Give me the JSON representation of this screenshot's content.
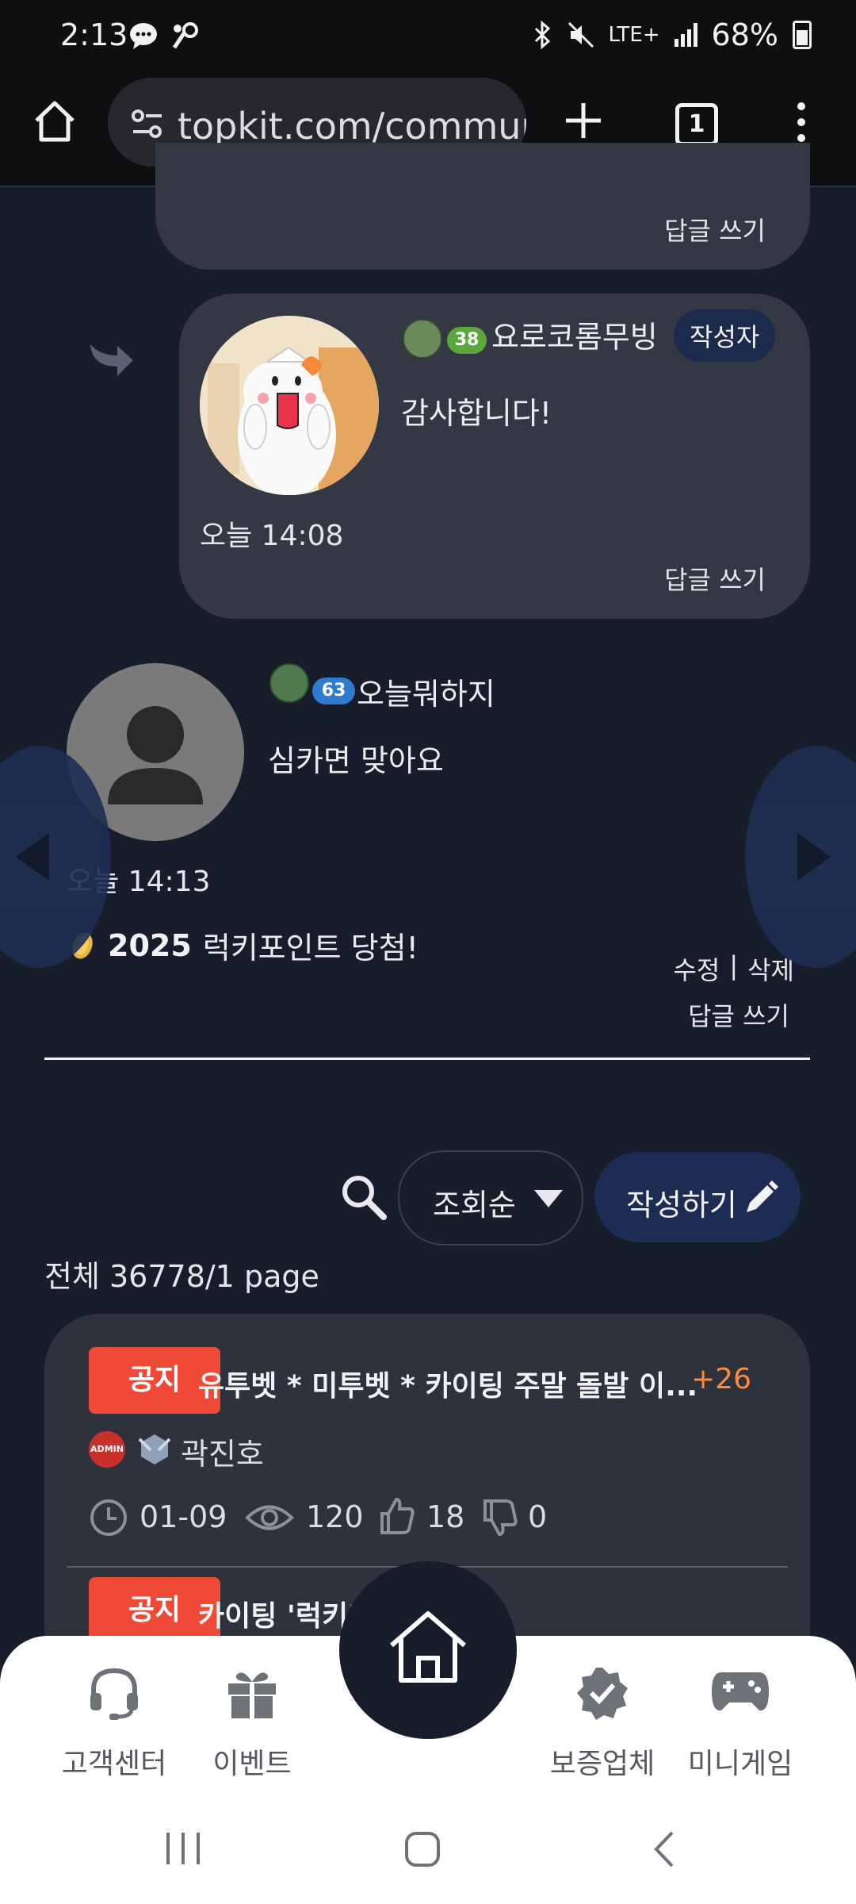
{
  "status_bar": {
    "time": "2:13",
    "network": "LTE+",
    "battery": "68%"
  },
  "browser": {
    "url": "topkit.com/communi",
    "tab_count": "1"
  },
  "comments": [
    {
      "reply_link": "답글 쓰기"
    },
    {
      "nickname": "요로코롬무빙",
      "level": "38",
      "author_badge": "작성자",
      "text": "감사합니다!",
      "time": "오늘 14:08",
      "reply_link": "답글 쓰기"
    },
    {
      "nickname": "오늘뭐하지",
      "level": "63",
      "text": "심카면 맞아요",
      "time": "오늘 14:13",
      "lucky_year": "2025",
      "lucky_text": "럭키포인트 당첨!",
      "edit": "수정",
      "separator": "|",
      "delete": "삭제",
      "reply_link": "답글 쓰기"
    }
  ],
  "toolbar": {
    "sort_label": "조회순",
    "write_label": "작성하기",
    "total_text": "전체 36778/1 page"
  },
  "posts": [
    {
      "badge": "공지",
      "title": "유투벳 * 미투벳 * 카이팅 주말 돌발 이...",
      "comment_count": "+26",
      "author_badge_text": "ADMIN",
      "author": "곽진호",
      "date": "01-09",
      "views": "120",
      "likes": "18",
      "dislikes": "0"
    },
    {
      "badge": "공지",
      "title": "카이팅 '럭키'"
    }
  ],
  "bottom_nav": {
    "items": [
      "고객센터",
      "이벤트",
      "보증업체",
      "미니게임"
    ]
  },
  "colors": {
    "background": "#181d2c",
    "card": "#333844",
    "notice_red": "#ef4a37",
    "accent_orange": "#ff8a3d",
    "button_navy": "#1c2c52"
  }
}
